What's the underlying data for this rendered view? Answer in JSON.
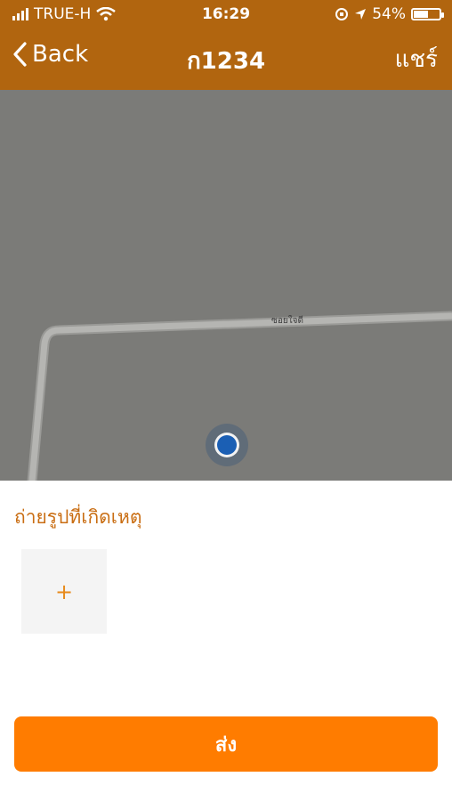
{
  "status_bar": {
    "carrier": "TRUE-H",
    "time": "16:29",
    "battery_percent": "54%",
    "battery_level": 0.54,
    "icons": [
      "signal-icon",
      "wifi-icon",
      "orientation-lock-icon",
      "location-arrow-icon",
      "battery-icon"
    ]
  },
  "nav": {
    "back_label": "Back",
    "title": "ก1234",
    "share_label": "แชร์"
  },
  "map": {
    "street_label": "ซอยใจดี"
  },
  "sheet": {
    "title": "ถ่ายรูปที่เกิดเหตุ",
    "add_photo_label": "+",
    "send_label": "ส่ง"
  },
  "colors": {
    "header": "#b1650f",
    "accent": "#ff7c00",
    "map": "#7b7b78",
    "title_text": "#c96d12"
  }
}
